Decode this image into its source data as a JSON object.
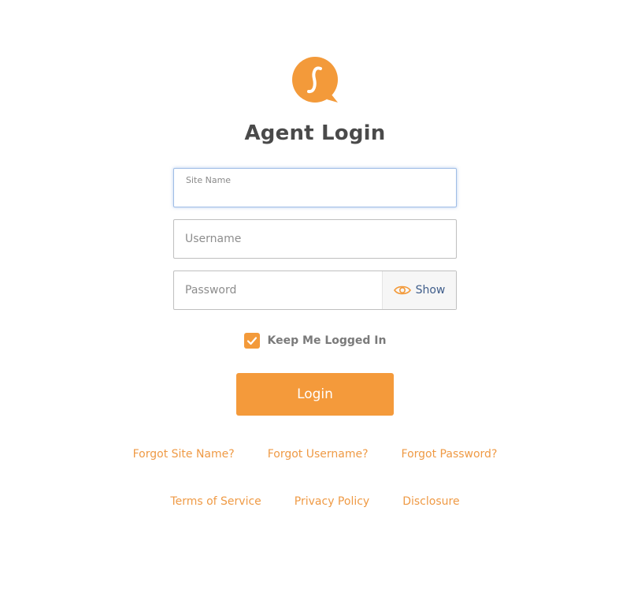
{
  "brand": {
    "logo_icon": "s-speech-bubble-icon",
    "accent_color": "#f39a3a"
  },
  "header": {
    "title": "Agent Login"
  },
  "form": {
    "site_name": {
      "label": "Site Name",
      "value": ""
    },
    "username": {
      "placeholder": "Username",
      "value": ""
    },
    "password": {
      "placeholder": "Password",
      "value": "",
      "show_label": "Show",
      "show_icon": "eye-icon"
    },
    "remember": {
      "label": "Keep Me Logged In",
      "checked": true
    },
    "submit_label": "Login"
  },
  "links": {
    "forgot_site_name": "Forgot Site Name?",
    "forgot_username": "Forgot Username?",
    "forgot_password": "Forgot Password?",
    "terms": "Terms of Service",
    "privacy": "Privacy Policy",
    "disclosure": "Disclosure"
  }
}
